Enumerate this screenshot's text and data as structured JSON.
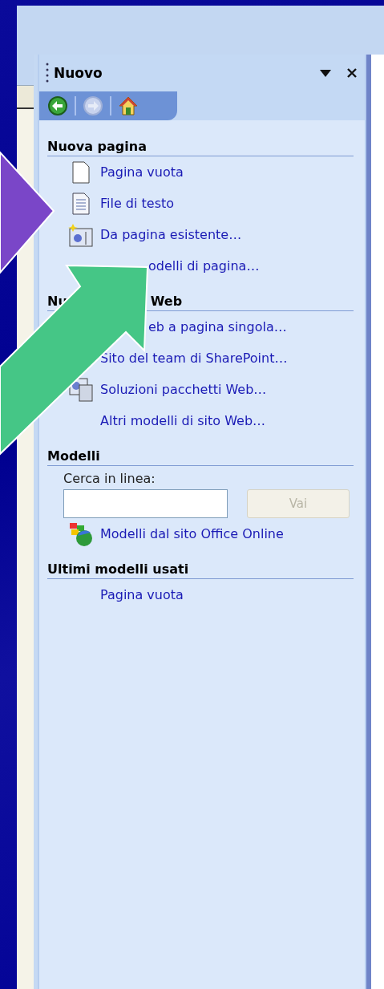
{
  "pane": {
    "title": "Nuovo",
    "nav": {
      "back_disabled": false,
      "forward_disabled": true
    },
    "sections": [
      {
        "heading": [
          "Nuova pagina"
        ],
        "items": [
          {
            "kind": "link",
            "text": "Pagina vuota"
          },
          {
            "kind": "link",
            "text": "File di testo"
          },
          {
            "kind": "link",
            "text": "Da pagina esistente…"
          },
          {
            "kind": "link",
            "text": "odelli di pagina…"
          }
        ]
      },
      {
        "heading": [
          "Nu",
          "Web"
        ],
        "items": [
          {
            "kind": "link",
            "text": "eb a pagina singola…"
          },
          {
            "kind": "link",
            "text": "Sito del team di SharePoint…"
          },
          {
            "kind": "link",
            "text": "Soluzioni pacchetti Web…"
          },
          {
            "kind": "link",
            "text": "Altri modelli di sito Web…"
          }
        ]
      },
      {
        "heading": [
          "Modelli"
        ],
        "items": [
          {
            "kind": "search",
            "label": "Cerca in linea:",
            "button": "Vai",
            "button_disabled": true
          },
          {
            "kind": "link",
            "text": "Modelli dal sito Office Online"
          }
        ]
      },
      {
        "heading": [
          "Ultimi modelli usati"
        ],
        "items": [
          {
            "kind": "link",
            "text": "Pagina vuota"
          }
        ]
      }
    ]
  }
}
